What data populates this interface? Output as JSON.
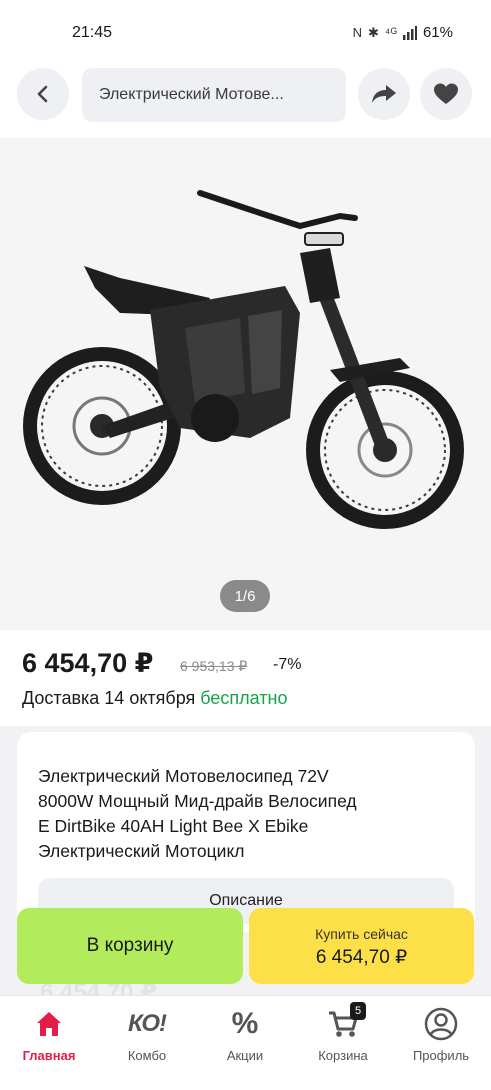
{
  "status_bar": {
    "time": "21:45",
    "nfc": "N",
    "bluetooth": "✱",
    "network": "⁴ᴳ",
    "battery": "61%"
  },
  "header": {
    "search_text": "Электрический Мотове...",
    "icons": {
      "back": "chevron-left-icon",
      "share": "share-arrow-icon",
      "favorite": "heart-icon"
    }
  },
  "gallery": {
    "counter": "1/6"
  },
  "price": {
    "current": "6 454,70 ₽",
    "old": "6 953,13 ₽",
    "discount": "-7%"
  },
  "delivery": {
    "prefix": "Доставка 14 октября",
    "free": "бесплатно"
  },
  "product": {
    "title_lines": [
      "Электрический Мотовелосипед 72V",
      "8000W Мощный Мид-драйв Велосипед",
      "E DirtBike 40AH Light Bee X Ebike",
      "Электрический Мотоцикл"
    ],
    "description_button": "Описание"
  },
  "actions": {
    "add_to_cart": "В корзину",
    "buy_now_label": "Купить сейчас",
    "buy_now_price": "6 454,70 ₽"
  },
  "nav": {
    "items": [
      {
        "label": "Главная",
        "icon": "home-icon",
        "active": true
      },
      {
        "label": "Комбо",
        "icon": "combo-icon",
        "icon_text": "КО!"
      },
      {
        "label": "Акции",
        "icon": "percent-icon",
        "icon_text": "%"
      },
      {
        "label": "Корзина",
        "icon": "cart-icon",
        "badge": "5"
      },
      {
        "label": "Профиль",
        "icon": "profile-icon"
      }
    ]
  },
  "colors": {
    "add_to_cart": "#b2ec5d",
    "buy_now": "#fde047",
    "free_delivery": "#15a34a",
    "active_nav": "#e11d48"
  }
}
